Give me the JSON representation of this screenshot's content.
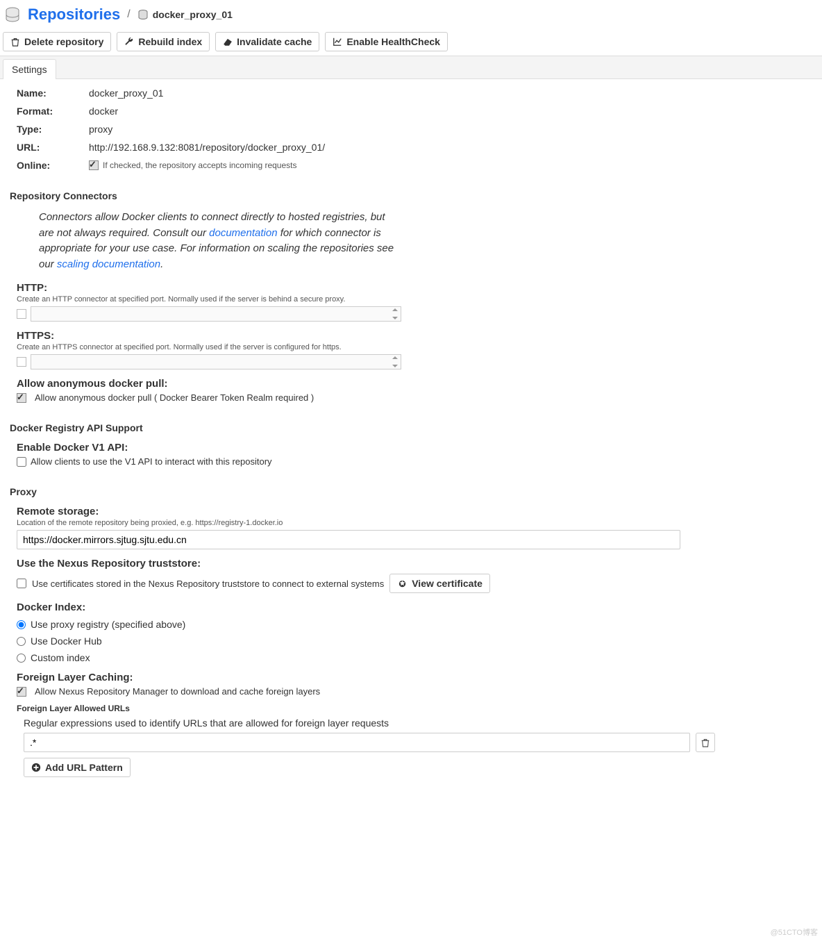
{
  "header": {
    "title": "Repositories",
    "repo_name": "docker_proxy_01"
  },
  "toolbar": {
    "delete": "Delete repository",
    "rebuild": "Rebuild index",
    "invalidate": "Invalidate cache",
    "health": "Enable HealthCheck"
  },
  "tabs": {
    "settings": "Settings"
  },
  "info": {
    "name_label": "Name:",
    "name_value": "docker_proxy_01",
    "format_label": "Format:",
    "format_value": "docker",
    "type_label": "Type:",
    "type_value": "proxy",
    "url_label": "URL:",
    "url_value": "http://192.168.9.132:8081/repository/docker_proxy_01/",
    "online_label": "Online:",
    "online_hint": "If checked, the repository accepts incoming requests"
  },
  "connectors": {
    "section": "Repository Connectors",
    "help_pre": "Connectors allow Docker clients to connect directly to hosted registries, but are not always required. Consult our ",
    "doc_link": "documentation",
    "help_mid": " for which connector is appropriate for your use case. For information on scaling the repositories see our ",
    "scale_link": "scaling documentation",
    "help_post": ".",
    "http_label": "HTTP:",
    "http_hint": "Create an HTTP connector at specified port. Normally used if the server is behind a secure proxy.",
    "https_label": "HTTPS:",
    "https_hint": "Create an HTTPS connector at specified port. Normally used if the server is configured for https.",
    "anon_label": "Allow anonymous docker pull:",
    "anon_cb": "Allow anonymous docker pull ( Docker Bearer Token Realm required )"
  },
  "registry": {
    "section": "Docker Registry API Support",
    "v1_label": "Enable Docker V1 API:",
    "v1_cb": "Allow clients to use the V1 API to interact with this repository"
  },
  "proxy": {
    "section": "Proxy",
    "remote_label": "Remote storage:",
    "remote_hint": "Location of the remote repository being proxied, e.g. https://registry-1.docker.io",
    "remote_value": "https://docker.mirrors.sjtug.sjtu.edu.cn",
    "trust_label": "Use the Nexus Repository truststore:",
    "trust_cb": "Use certificates stored in the Nexus Repository truststore to connect to external systems",
    "view_cert": "View certificate",
    "index_label": "Docker Index:",
    "index_opt1": "Use proxy registry (specified above)",
    "index_opt2": "Use Docker Hub",
    "index_opt3": "Custom index",
    "foreign_label": "Foreign Layer Caching:",
    "foreign_cb": "Allow Nexus Repository Manager to download and cache foreign layers",
    "allowed_urls_label": "Foreign Layer Allowed URLs",
    "allowed_urls_desc": "Regular expressions used to identify URLs that are allowed for foreign layer requests",
    "pattern_value": ".*",
    "add_pattern": "Add URL Pattern"
  },
  "watermark": "@51CTO博客"
}
